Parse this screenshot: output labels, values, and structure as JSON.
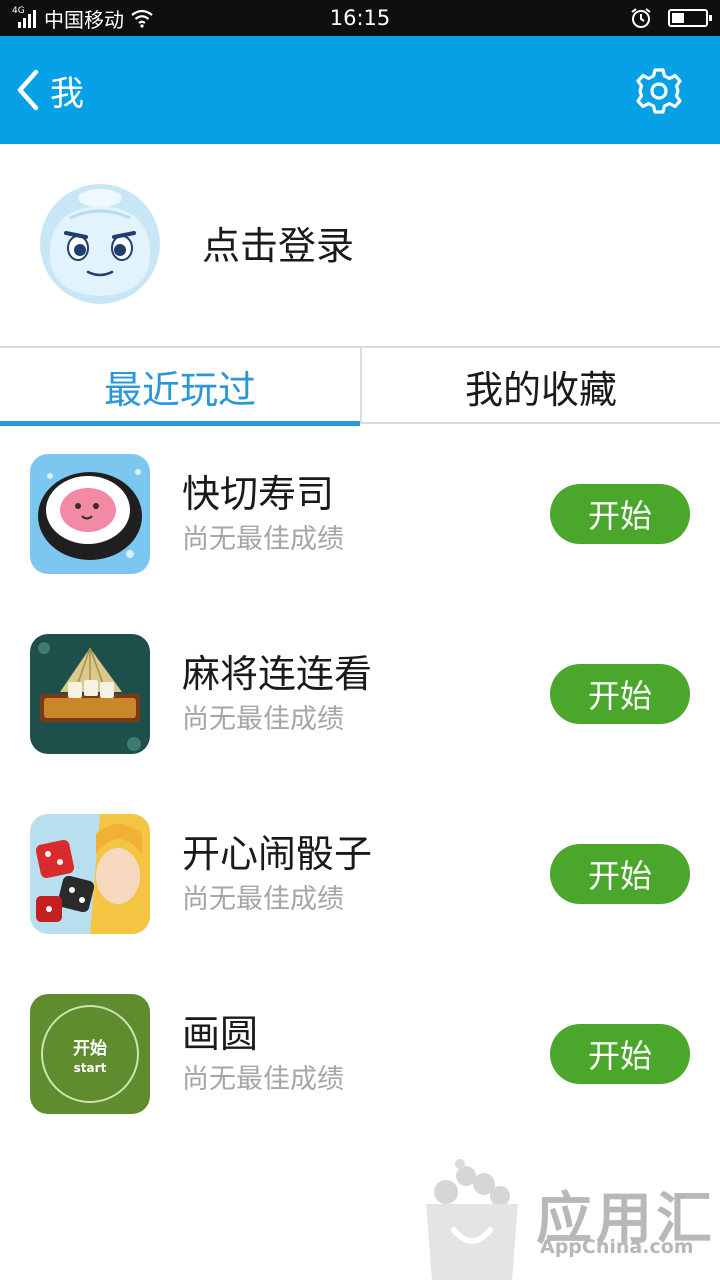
{
  "status_bar": {
    "network_tag": "4G",
    "carrier": "中国移动",
    "time": "16:15",
    "icons": [
      "signal-icon",
      "wifi-icon",
      "alarm-icon",
      "battery-icon"
    ]
  },
  "header": {
    "title": "我",
    "back_icon": "chevron-left-icon",
    "settings_icon": "gear-icon",
    "background_color": "#06a0e6"
  },
  "profile": {
    "login_label": "点击登录",
    "avatar_icon": "mascot-avatar"
  },
  "tabs": [
    {
      "label": "最近玩过",
      "active": true
    },
    {
      "label": "我的收藏",
      "active": false
    }
  ],
  "games": [
    {
      "name": "快切寿司",
      "subtitle": "尚无最佳成绩",
      "button_label": "开始",
      "icon": "sushi-game-icon"
    },
    {
      "name": "麻将连连看",
      "subtitle": "尚无最佳成绩",
      "button_label": "开始",
      "icon": "mahjong-game-icon"
    },
    {
      "name": "开心闹骰子",
      "subtitle": "尚无最佳成绩",
      "button_label": "开始",
      "icon": "dice-game-icon"
    },
    {
      "name": "画圆",
      "subtitle": "尚无最佳成绩",
      "button_label": "开始",
      "icon": "draw-circle-game-icon",
      "icon_text_cn": "开始",
      "icon_text_en": "start"
    }
  ],
  "watermark": {
    "text": "应用汇",
    "subtext": "AppChina.com"
  },
  "colors": {
    "accent": "#2a97d8",
    "start_button": "#4aa72c",
    "subtitle": "#a6a6a6"
  }
}
